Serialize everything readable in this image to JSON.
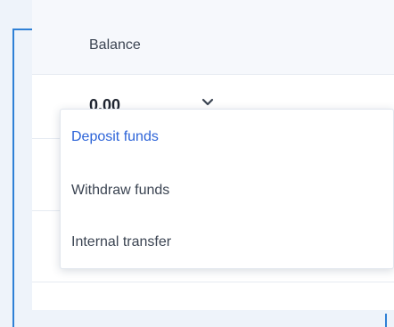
{
  "balance": {
    "label": "Balance",
    "value": "0.00"
  },
  "dropdown": {
    "items": [
      {
        "label": "Deposit funds",
        "active": true
      },
      {
        "label": "Withdraw funds",
        "active": false
      },
      {
        "label": "Internal transfer",
        "active": false
      }
    ]
  },
  "colors": {
    "accent_border": "#2f80d6",
    "active_item": "#2d64d8",
    "text": "#3b4452"
  },
  "icons": {
    "chevron": "chevron-down-icon"
  }
}
